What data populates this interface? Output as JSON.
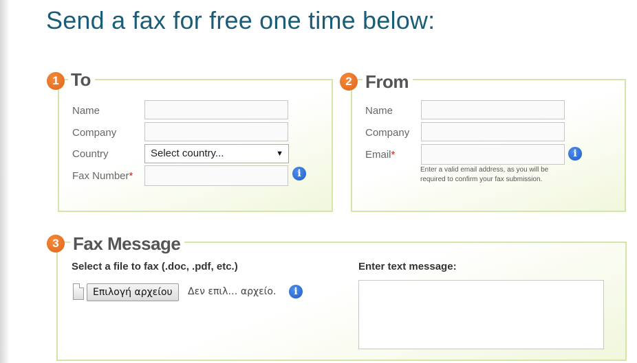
{
  "page": {
    "title": "Send a fax for free one time below:"
  },
  "to_section": {
    "number": "1",
    "title": "To",
    "name_label": "Name",
    "name_value": "",
    "company_label": "Company",
    "company_value": "",
    "country_label": "Country",
    "country_selected": "Select country...",
    "fax_label": "Fax Number",
    "fax_value": "",
    "required_mark": "*"
  },
  "from_section": {
    "number": "2",
    "title": "From",
    "name_label": "Name",
    "name_value": "",
    "company_label": "Company",
    "company_value": "",
    "email_label": "Email",
    "email_value": "",
    "required_mark": "*",
    "email_hint_line1": "Enter a valid email address, as you will be",
    "email_hint_line2": "required to confirm your fax submission."
  },
  "message_section": {
    "number": "3",
    "title": "Fax Message",
    "file_label": "Select a file to fax (.doc, .pdf, etc.)",
    "file_button": "Επιλογή αρχείου",
    "file_status": "Δεν επιλ… αρχείο.",
    "text_label": "Enter text message:",
    "text_value": ""
  },
  "icons": {
    "info": "info-icon",
    "file": "file-icon",
    "dropdown": "chevron-down-icon"
  },
  "colors": {
    "title": "#1b5d77",
    "badge": "#e8772a",
    "panel_border": "#d3e5a8",
    "panel_tint": "#f1f7dc",
    "info": "#2b6fd6",
    "required": "#cc2222"
  }
}
